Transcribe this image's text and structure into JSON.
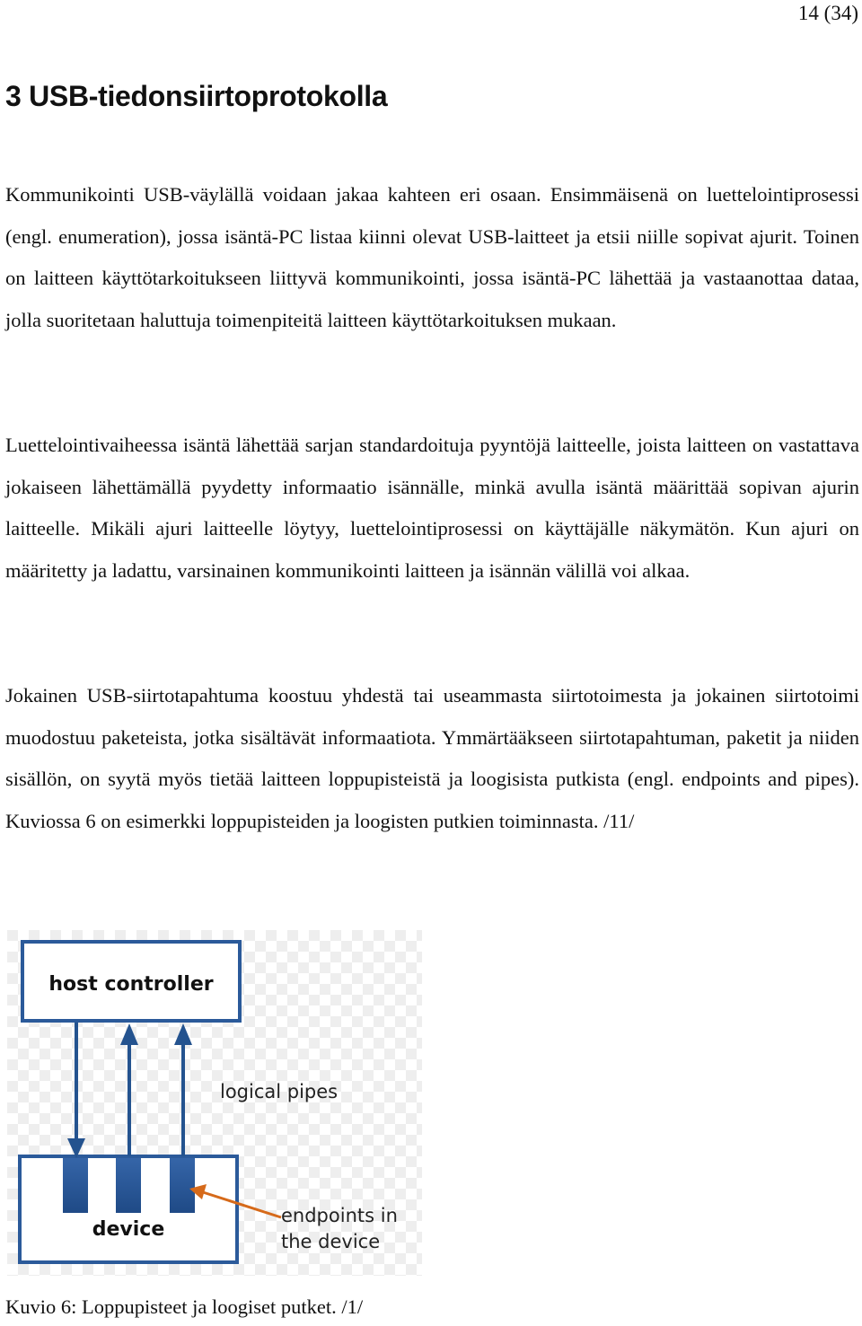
{
  "page_number": "14 (34)",
  "heading": "3 USB-tiedonsiirtoprotokolla",
  "paragraphs": [
    "Kommunikointi USB-väylällä voidaan jakaa kahteen eri osaan. Ensimmäisenä on luettelointiprosessi (engl. enumeration), jossa isäntä-PC listaa kiinni olevat USB-laitteet ja etsii niille sopivat ajurit. Toinen on laitteen käyttötarkoitukseen liittyvä kommunikointi, jossa isäntä-PC lähettää ja vastaanottaa dataa, jolla suoritetaan haluttuja toimenpiteitä laitteen käyttötarkoituksen mukaan.",
    "Luettelointivaiheessa isäntä lähettää sarjan standardoituja pyyntöjä laitteelle, joista laitteen on vastattava jokaiseen lähettämällä pyydetty informaatio isännälle, minkä avulla isäntä määrittää sopivan ajurin laitteelle. Mikäli ajuri laitteelle löytyy, luettelointiprosessi on käyttäjälle näkymätön. Kun ajuri on määritetty ja ladattu, varsinainen kommunikointi laitteen ja isännän välillä voi alkaa.",
    "Jokainen USB-siirtotapahtuma koostuu yhdestä tai useammasta siirtotoimesta ja jokainen siirtotoimi muodostuu paketeista, jotka sisältävät informaatiota. Ymmärtääkseen siirtotapahtuman, paketit ja niiden sisällön, on syytä myös tietää laitteen loppupisteistä ja loogisista putkista (engl. endpoints and pipes). Kuviossa 6 on esimerkki loppupisteiden ja loogisten putkien toiminnasta. /11/"
  ],
  "figure": {
    "host_label": "host controller",
    "device_label": "device",
    "pipes_label": "logical pipes",
    "endpoints_label_line1": "endpoints in",
    "endpoints_label_line2": "the device",
    "colors": {
      "box_border": "#2b5a9a",
      "endpoint_fill_top": "#3565a8",
      "endpoint_fill_bottom": "#1f4a86",
      "arrow": "#24538f",
      "pointer_arrow": "#d66a1a",
      "checker_light": "#ffffff",
      "checker_dark": "#eeeeee"
    }
  },
  "caption": "Kuvio 6: Loppupisteet ja loogiset putket. /1/"
}
